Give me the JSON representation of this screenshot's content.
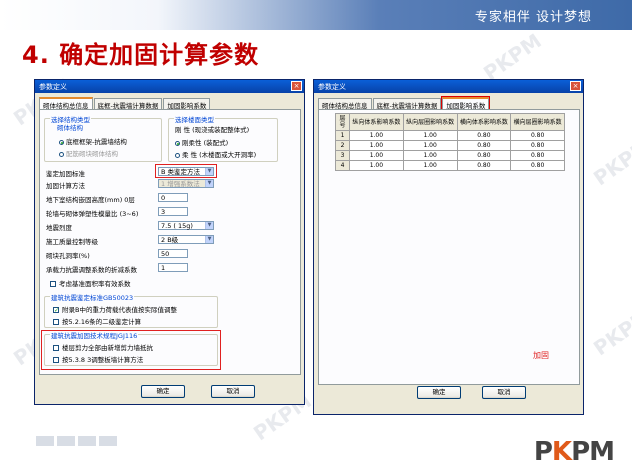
{
  "slide": {
    "slogan": "专家相伴  设计梦想",
    "title_num": "4.",
    "title_text": "确定加固计算参数",
    "logo_p": "P",
    "logo_k": "K",
    "logo_p2": "P",
    "logo_m": "M",
    "watermarks": [
      "PKPM",
      "PKPM",
      "PKPM",
      "PKPM",
      "PKPM",
      "PKPM"
    ]
  },
  "left_dialog": {
    "title": "参数定义",
    "close": "×",
    "tabs": [
      "砌体结构总信息",
      "底框-抗震墙计算数据",
      "加固影响系数"
    ],
    "group_type": {
      "label": "选择结构类型",
      "sublabel": "砌体结构",
      "option1": "底框框架-抗震墙结构",
      "option2": "配筋砌块砌体结构"
    },
    "group_floor": {
      "label": "选择楼面类型",
      "line1": "刚  性 (现浇或装配整体式)",
      "option1": "刚柔性 (装配式)",
      "option2": "柔  性 (木楼面或大开洞率)"
    },
    "fields": [
      {
        "label": "鉴定加固标准",
        "value": "B 类鉴定方法"
      },
      {
        "label": "加固计算方法",
        "value": "1  增强系数法"
      },
      {
        "label": "地下室结构嵌固高度(mm)  0层",
        "value": "0"
      },
      {
        "label": "轮墙与砌体弹塑性模量比 (3~6)",
        "value": "3"
      },
      {
        "label": "地震烈度",
        "value": "7.5 ( 15g)"
      },
      {
        "label": "施工质量控制等级",
        "value": "2 B级"
      },
      {
        "label": "砌块孔洞率(%)",
        "value": "50"
      },
      {
        "label": "承载力抗震调整系数的折减系数",
        "value": "1"
      }
    ],
    "check_base": "考虑基准面积率有效系数",
    "group_gb": {
      "label": "建筑抗震鉴定标准GB50023",
      "opt1": "附录B中的重力荷载代表值按实际值调整",
      "opt2": "按5.2.16条的二级鉴定计算"
    },
    "group_jgj": {
      "label": "建筑抗震加固技术规程JGJ116",
      "opt1": "楼层剪力全部由新增剪力墙抵抗",
      "opt2": "按5.3.8 3调整板墙计算方法"
    },
    "ok": "确定",
    "cancel": "取消"
  },
  "right_dialog": {
    "title": "参数定义",
    "close": "×",
    "tabs": [
      "砌体结构总信息",
      "底框-抗震墙计算数据",
      "加固影响系数"
    ],
    "table": {
      "headers": [
        "层号",
        "纵向体系影响系数",
        "纵向层圈影响系数",
        "横向体系影响系数",
        "横向层圈影响系数"
      ],
      "rows": [
        [
          "1",
          "1.00",
          "1.00",
          "0.80",
          "0.80"
        ],
        [
          "2",
          "1.00",
          "1.00",
          "0.80",
          "0.80"
        ],
        [
          "3",
          "1.00",
          "1.00",
          "0.80",
          "0.80"
        ],
        [
          "4",
          "1.00",
          "1.00",
          "0.80",
          "0.80"
        ]
      ]
    },
    "annotation": "加固",
    "ok": "确定",
    "cancel": "取消"
  }
}
